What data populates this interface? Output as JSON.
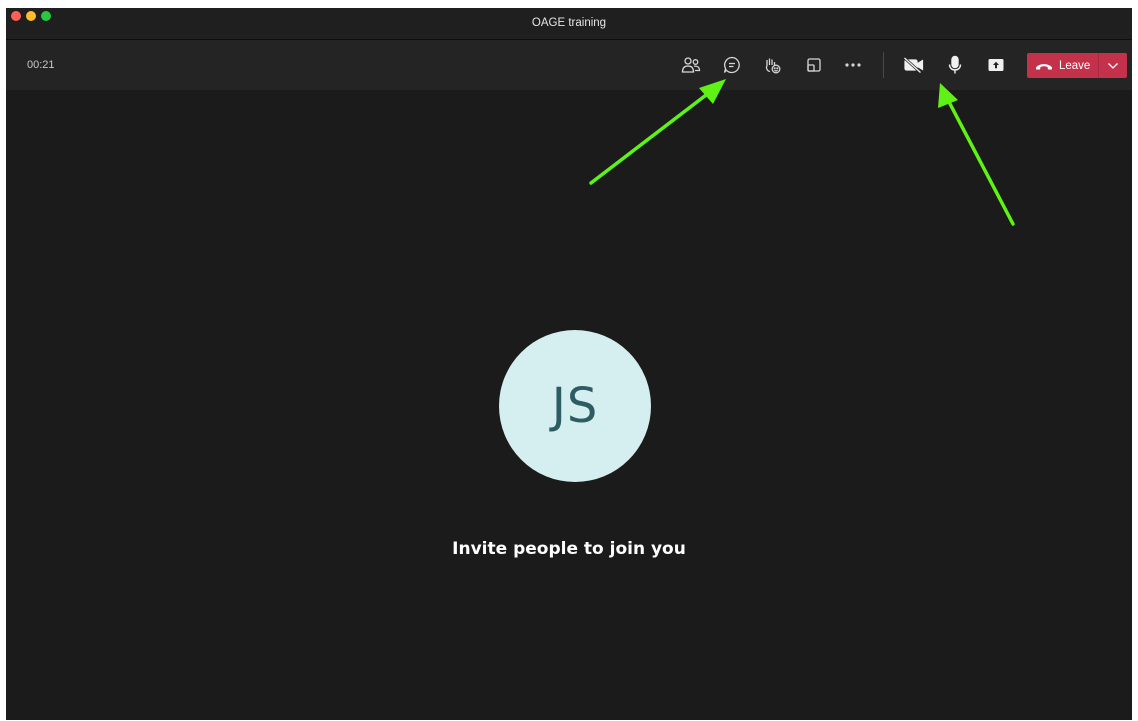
{
  "window": {
    "title": "OAGE training"
  },
  "toolbar": {
    "timer": "00:21",
    "buttons": [
      {
        "name": "participants",
        "icon": "people-icon"
      },
      {
        "name": "chat",
        "icon": "chat-icon"
      },
      {
        "name": "reactions",
        "icon": "raise-hand-icon"
      },
      {
        "name": "rooms",
        "icon": "breakout-rooms-icon"
      },
      {
        "name": "more",
        "icon": "more-actions-icon"
      },
      {
        "name": "camera",
        "icon": "camera-off-icon"
      },
      {
        "name": "mic",
        "icon": "microphone-icon"
      },
      {
        "name": "share",
        "icon": "share-screen-icon"
      }
    ],
    "leave": {
      "label": "Leave",
      "icon": "hang-up-icon",
      "color": "#c4314b"
    }
  },
  "stage": {
    "avatar_initials": "JS",
    "avatar_bg": "#d5eef0",
    "avatar_fg": "#2d5d62",
    "message": "Invite people to join you"
  },
  "annotations": {
    "arrow_color": "#5ff215"
  }
}
